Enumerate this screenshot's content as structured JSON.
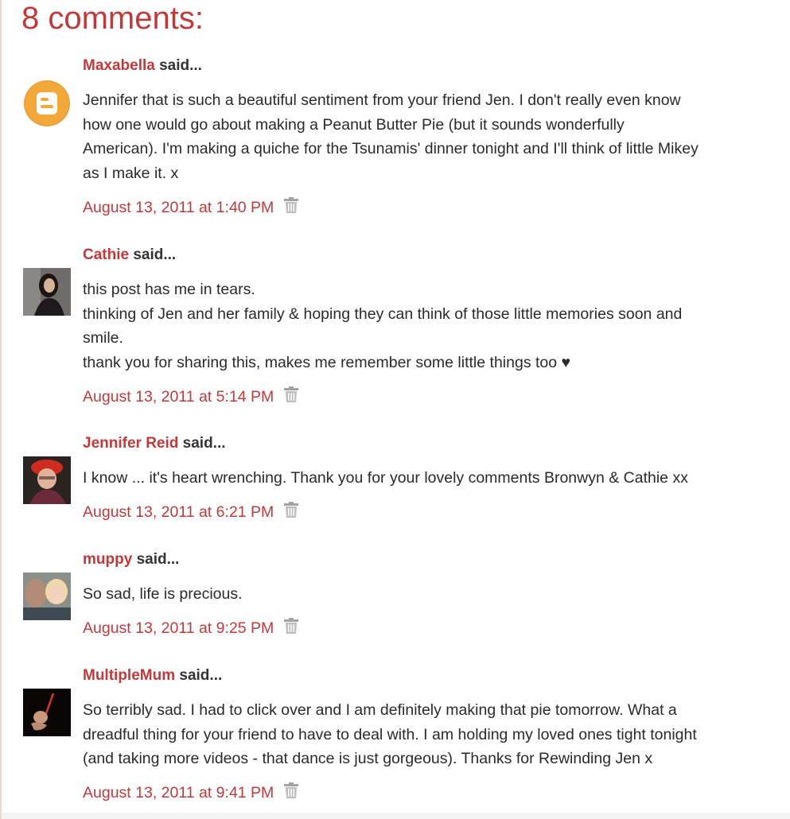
{
  "heading": "8 comments:",
  "said_suffix": "said...",
  "colors": {
    "accent": "#c0393b",
    "text": "#2a2a2a",
    "left_border": "#efd9c6"
  },
  "comments": [
    {
      "author": "Maxabella",
      "avatar_icon": "blogger-icon",
      "lines": [
        "Jennifer that is such a beautiful sentiment from your friend Jen. I don't really even know",
        "how one would go about making a Peanut Butter Pie (but it sounds wonderfully",
        "American). I'm making a quiche for the Tsunamis' dinner tonight and I'll think of little Mikey",
        "as I make it. x"
      ],
      "timestamp": "August 13, 2011 at 1:40 PM"
    },
    {
      "author": "Cathie",
      "avatar_icon": "avatar-photo",
      "lines": [
        "this post has me in tears.",
        "thinking of Jen and her family & hoping they can think of those little memories soon and",
        "smile.",
        "thank you for sharing this, makes me remember some little things too ♥"
      ],
      "timestamp": "August 13, 2011 at 5:14 PM"
    },
    {
      "author": "Jennifer Reid",
      "avatar_icon": "avatar-photo",
      "lines": [
        "I know ... it's heart wrenching. Thank you for your lovely comments Bronwyn & Cathie xx"
      ],
      "timestamp": "August 13, 2011 at 6:21 PM"
    },
    {
      "author": "muppy",
      "avatar_icon": "avatar-photo",
      "lines": [
        "So sad, life is precious."
      ],
      "timestamp": "August 13, 2011 at 9:25 PM"
    },
    {
      "author": "MultipleMum",
      "avatar_icon": "avatar-photo",
      "lines": [
        "So terribly sad. I had to click over and I am definitely making that pie tomorrow. What a",
        "dreadful thing for your friend to have to deal with. I am holding my loved ones tight tonight",
        "(and taking more videos - that dance is just gorgeous). Thanks for Rewinding Jen x"
      ],
      "timestamp": "August 13, 2011 at 9:41 PM"
    }
  ]
}
